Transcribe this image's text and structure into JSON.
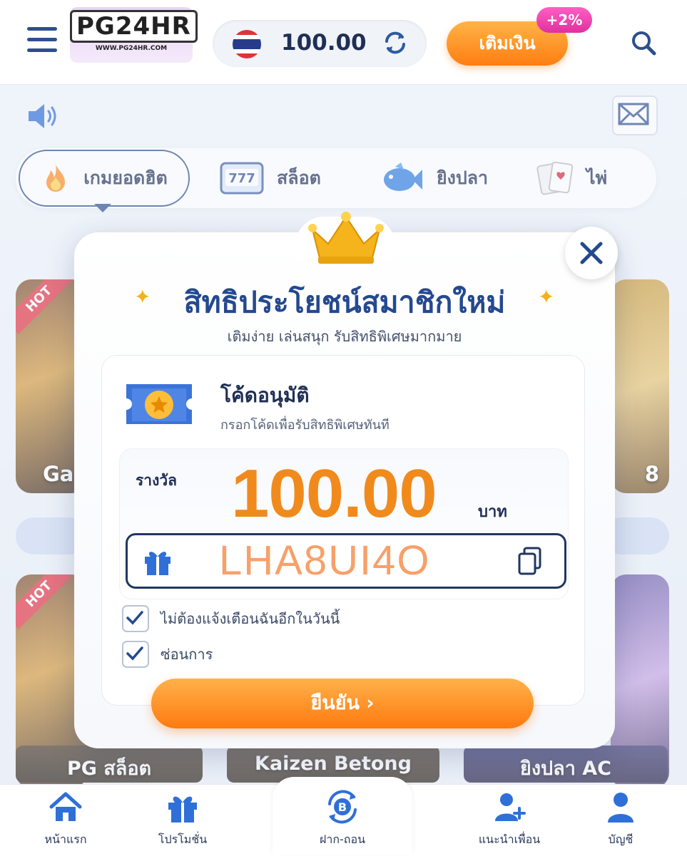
{
  "header": {
    "logo_text": "PG24HR",
    "logo_url_text": "WWW.PG24HR.COM",
    "balance": "100.00",
    "deposit_label": "เติมเงิน",
    "bonus_badge": "+2%"
  },
  "categories": [
    {
      "label": "เกมยอดฮิต",
      "icon": "fire-icon",
      "active": true
    },
    {
      "label": "สล็อต",
      "icon": "slot-machine-icon"
    },
    {
      "label": "ยิงปลา",
      "icon": "fish-icon"
    },
    {
      "label": "ไพ่",
      "icon": "cards-icon"
    }
  ],
  "background_cards": {
    "hot_badge": "HOT",
    "card1_label_partial": "Ga",
    "card2_label_partial": "8",
    "bottom_labels": [
      "PG  สล็อต",
      "Kaizen Betong",
      "ยิงปลา AC"
    ]
  },
  "modal": {
    "title": "สิทธิประโยชน์สมาชิกใหม่",
    "subtitle": "เติมง่าย เล่นสนุก รับสิทธิพิเศษมากมาย",
    "code_title": "โค้ดอนุมัติ",
    "code_desc": "กรอกโค้ดเพื่อรับสิทธิพิเศษทันที",
    "reward_label": "รางวัล",
    "reward_amount": "100.00",
    "reward_unit": "บาท",
    "code_value": "LHA8UI4O",
    "checkbox1_label": "ไม่ต้องแจ้งเตือนฉันอีกในวันนี้",
    "checkbox2_label": "ซ่อนการ",
    "confirm_label": "ยืนยัน  ›"
  },
  "bottom_nav": [
    {
      "label": "หน้าแรก",
      "icon": "home-icon"
    },
    {
      "label": "โปรโมชั่น",
      "icon": "gift-icon"
    },
    {
      "label": "ฝาก-ถอน",
      "icon": "bitcoin-exchange-icon"
    },
    {
      "label": "แนะนำเพื่อน",
      "icon": "add-user-icon"
    },
    {
      "label": "บัญชี",
      "icon": "user-icon"
    }
  ],
  "colors": {
    "primary": "#24498f",
    "accent_orange": "#ff7e12",
    "reward_orange": "#f18a1c",
    "badge_pink": "#e0309e"
  }
}
